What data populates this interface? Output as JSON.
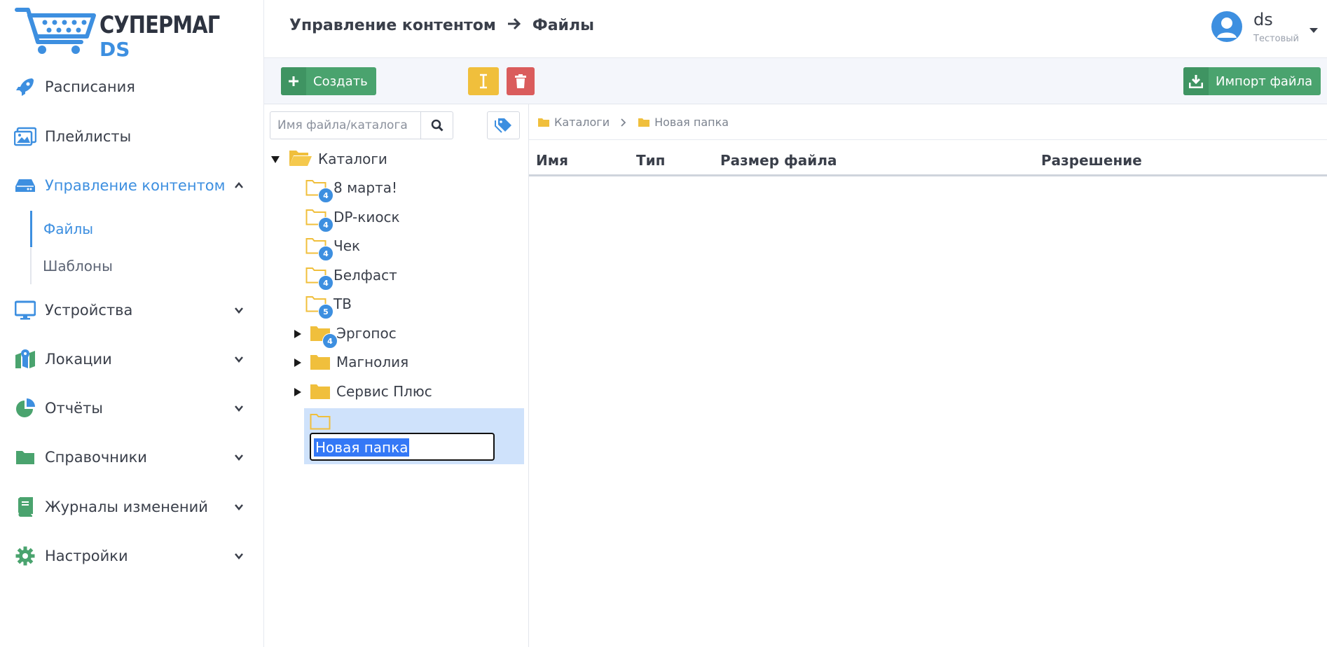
{
  "brand": {
    "line1": "СУПЕРМАГ",
    "line2": "DS"
  },
  "sidebar": {
    "items": [
      {
        "label": "Расписания"
      },
      {
        "label": "Плейлисты"
      },
      {
        "label": "Управление контентом"
      },
      {
        "label": "Устройства"
      },
      {
        "label": "Локации"
      },
      {
        "label": "Отчёты"
      },
      {
        "label": "Справочники"
      },
      {
        "label": "Журналы изменений"
      },
      {
        "label": "Настройки"
      }
    ],
    "sub_items": [
      {
        "label": "Файлы"
      },
      {
        "label": "Шаблоны"
      }
    ]
  },
  "header": {
    "breadcrumb": [
      "Управление контентом",
      "Файлы"
    ],
    "user": {
      "name": "ds",
      "role": "Тестовый"
    }
  },
  "toolbar": {
    "create_label": "Создать",
    "import_label": "Импорт файла"
  },
  "tree": {
    "search_placeholder": "Имя файла/каталога",
    "root": "Каталоги",
    "folders": [
      {
        "label": "8 марта!",
        "badge": "4"
      },
      {
        "label": "DP-киоск",
        "badge": "4"
      },
      {
        "label": "Чек",
        "badge": "4"
      },
      {
        "label": "Белфаст",
        "badge": "4"
      },
      {
        "label": "ТВ",
        "badge": "5"
      },
      {
        "label": "Эргопос",
        "badge": "4"
      },
      {
        "label": "Магнолия"
      },
      {
        "label": "Сервис Плюс"
      }
    ],
    "new_folder_value": "Новая папка"
  },
  "content": {
    "breadcrumb": [
      "Каталоги",
      "Новая папка"
    ],
    "columns": [
      "Имя",
      "Тип",
      "Размер файла",
      "Разрешение"
    ]
  },
  "colors": {
    "accent": "#3d8fe0",
    "green": "#4aa36e",
    "yellow": "#f0bf3c",
    "red": "#da5c5c",
    "folder": "#f0bf3c"
  }
}
